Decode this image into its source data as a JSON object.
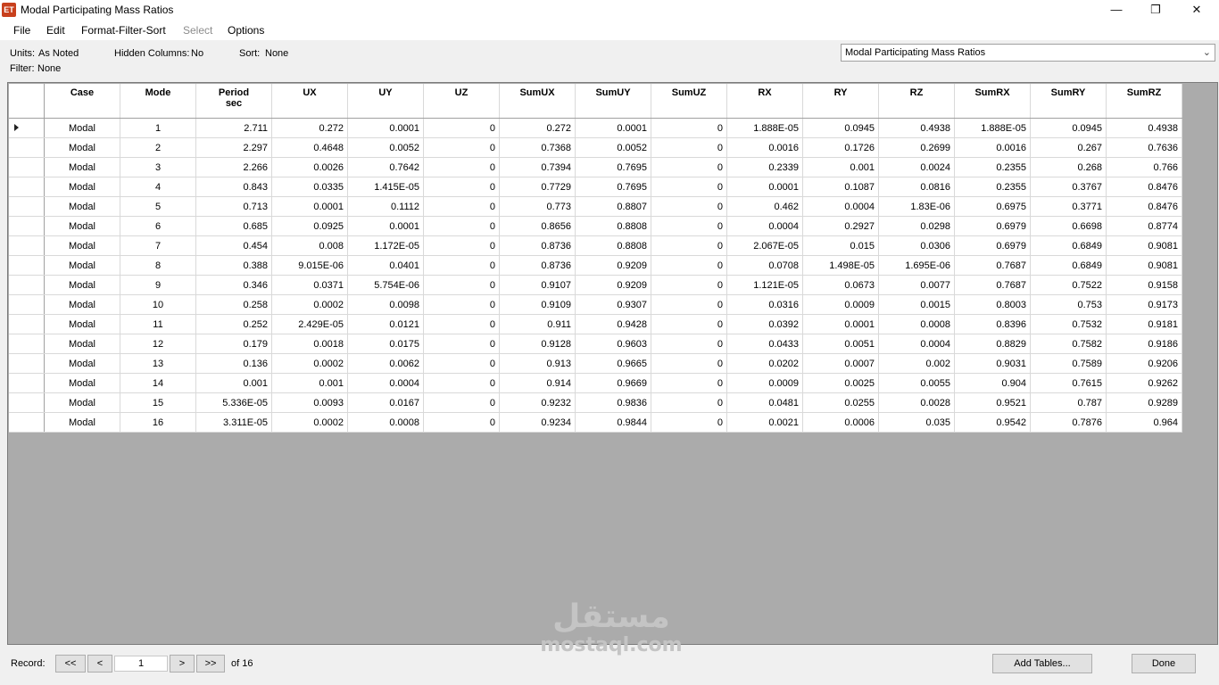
{
  "window": {
    "app_icon": "ET",
    "title": "Modal Participating Mass Ratios",
    "minimize": "—",
    "maximize": "❐",
    "close": "✕"
  },
  "menu": [
    "File",
    "Edit",
    "Format-Filter-Sort",
    "Select",
    "Options"
  ],
  "info": {
    "units_label": "Units:",
    "units_value": "As Noted",
    "hidden_label": "Hidden Columns:",
    "hidden_value": "No",
    "sort_label": "Sort:",
    "sort_value": "None",
    "filter_label": "Filter:",
    "filter_value": "None"
  },
  "table_select": {
    "value": "Modal Participating Mass Ratios"
  },
  "columns": [
    {
      "label": "Case",
      "unit": ""
    },
    {
      "label": "Mode",
      "unit": ""
    },
    {
      "label": "Period",
      "unit": "sec"
    },
    {
      "label": "UX",
      "unit": ""
    },
    {
      "label": "UY",
      "unit": ""
    },
    {
      "label": "UZ",
      "unit": ""
    },
    {
      "label": "SumUX",
      "unit": ""
    },
    {
      "label": "SumUY",
      "unit": ""
    },
    {
      "label": "SumUZ",
      "unit": ""
    },
    {
      "label": "RX",
      "unit": ""
    },
    {
      "label": "RY",
      "unit": ""
    },
    {
      "label": "RZ",
      "unit": ""
    },
    {
      "label": "SumRX",
      "unit": ""
    },
    {
      "label": "SumRY",
      "unit": ""
    },
    {
      "label": "SumRZ",
      "unit": ""
    }
  ],
  "rows": [
    [
      "Modal",
      "1",
      "2.711",
      "0.272",
      "0.0001",
      "0",
      "0.272",
      "0.0001",
      "0",
      "1.888E-05",
      "0.0945",
      "0.4938",
      "1.888E-05",
      "0.0945",
      "0.4938"
    ],
    [
      "Modal",
      "2",
      "2.297",
      "0.4648",
      "0.0052",
      "0",
      "0.7368",
      "0.0052",
      "0",
      "0.0016",
      "0.1726",
      "0.2699",
      "0.0016",
      "0.267",
      "0.7636"
    ],
    [
      "Modal",
      "3",
      "2.266",
      "0.0026",
      "0.7642",
      "0",
      "0.7394",
      "0.7695",
      "0",
      "0.2339",
      "0.001",
      "0.0024",
      "0.2355",
      "0.268",
      "0.766"
    ],
    [
      "Modal",
      "4",
      "0.843",
      "0.0335",
      "1.415E-05",
      "0",
      "0.7729",
      "0.7695",
      "0",
      "0.0001",
      "0.1087",
      "0.0816",
      "0.2355",
      "0.3767",
      "0.8476"
    ],
    [
      "Modal",
      "5",
      "0.713",
      "0.0001",
      "0.1112",
      "0",
      "0.773",
      "0.8807",
      "0",
      "0.462",
      "0.0004",
      "1.83E-06",
      "0.6975",
      "0.3771",
      "0.8476"
    ],
    [
      "Modal",
      "6",
      "0.685",
      "0.0925",
      "0.0001",
      "0",
      "0.8656",
      "0.8808",
      "0",
      "0.0004",
      "0.2927",
      "0.0298",
      "0.6979",
      "0.6698",
      "0.8774"
    ],
    [
      "Modal",
      "7",
      "0.454",
      "0.008",
      "1.172E-05",
      "0",
      "0.8736",
      "0.8808",
      "0",
      "2.067E-05",
      "0.015",
      "0.0306",
      "0.6979",
      "0.6849",
      "0.9081"
    ],
    [
      "Modal",
      "8",
      "0.388",
      "9.015E-06",
      "0.0401",
      "0",
      "0.8736",
      "0.9209",
      "0",
      "0.0708",
      "1.498E-05",
      "1.695E-06",
      "0.7687",
      "0.6849",
      "0.9081"
    ],
    [
      "Modal",
      "9",
      "0.346",
      "0.0371",
      "5.754E-06",
      "0",
      "0.9107",
      "0.9209",
      "0",
      "1.121E-05",
      "0.0673",
      "0.0077",
      "0.7687",
      "0.7522",
      "0.9158"
    ],
    [
      "Modal",
      "10",
      "0.258",
      "0.0002",
      "0.0098",
      "0",
      "0.9109",
      "0.9307",
      "0",
      "0.0316",
      "0.0009",
      "0.0015",
      "0.8003",
      "0.753",
      "0.9173"
    ],
    [
      "Modal",
      "11",
      "0.252",
      "2.429E-05",
      "0.0121",
      "0",
      "0.911",
      "0.9428",
      "0",
      "0.0392",
      "0.0001",
      "0.0008",
      "0.8396",
      "0.7532",
      "0.9181"
    ],
    [
      "Modal",
      "12",
      "0.179",
      "0.0018",
      "0.0175",
      "0",
      "0.9128",
      "0.9603",
      "0",
      "0.0433",
      "0.0051",
      "0.0004",
      "0.8829",
      "0.7582",
      "0.9186"
    ],
    [
      "Modal",
      "13",
      "0.136",
      "0.0002",
      "0.0062",
      "0",
      "0.913",
      "0.9665",
      "0",
      "0.0202",
      "0.0007",
      "0.002",
      "0.9031",
      "0.7589",
      "0.9206"
    ],
    [
      "Modal",
      "14",
      "0.001",
      "0.001",
      "0.0004",
      "0",
      "0.914",
      "0.9669",
      "0",
      "0.0009",
      "0.0025",
      "0.0055",
      "0.904",
      "0.7615",
      "0.9262"
    ],
    [
      "Modal",
      "15",
      "5.336E-05",
      "0.0093",
      "0.0167",
      "0",
      "0.9232",
      "0.9836",
      "0",
      "0.0481",
      "0.0255",
      "0.0028",
      "0.9521",
      "0.787",
      "0.9289"
    ],
    [
      "Modal",
      "16",
      "3.311E-05",
      "0.0002",
      "0.0008",
      "0",
      "0.9234",
      "0.9844",
      "0",
      "0.0021",
      "0.0006",
      "0.035",
      "0.9542",
      "0.7876",
      "0.964"
    ]
  ],
  "record_nav": {
    "label": "Record:",
    "first": "<<",
    "prev": "<",
    "current": "1",
    "next": ">",
    "last": ">>",
    "of_text": "of 16"
  },
  "buttons": {
    "add_tables": "Add Tables...",
    "done": "Done"
  },
  "watermark": {
    "arabic": "مستقل",
    "latin": "mostaql.com"
  }
}
